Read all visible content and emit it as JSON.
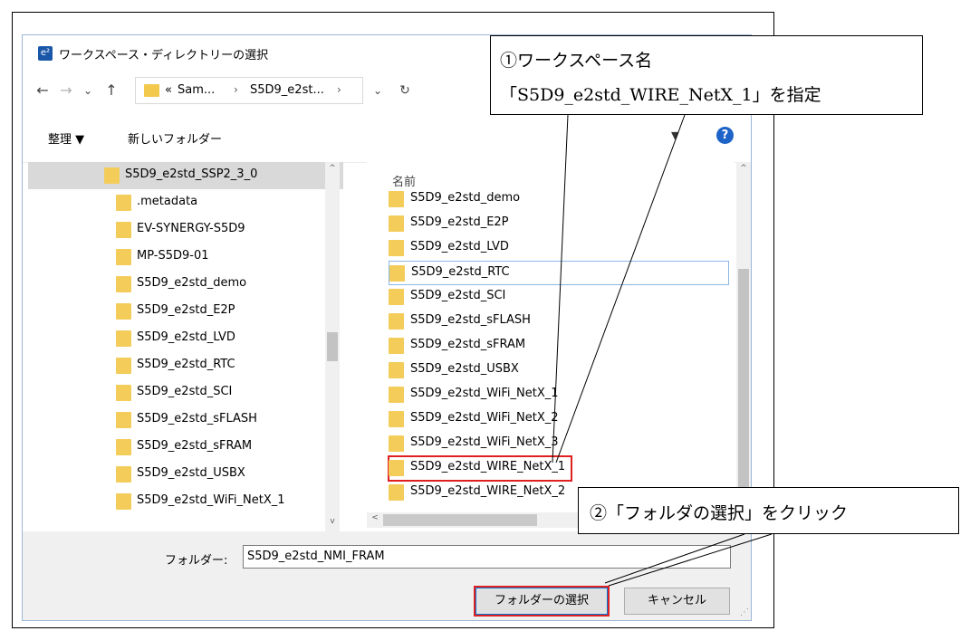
{
  "window": {
    "app_icon_text": "e²",
    "title": "ワークスペース・ディレクトリーの選択"
  },
  "nav": {
    "back": "←",
    "forward": "→",
    "history": "⌄",
    "up": "↑",
    "dropdown": "⌄",
    "refresh": "↻"
  },
  "address": {
    "overflow": "«",
    "crumbs": [
      "Sam...",
      "S5D9_e2st..."
    ],
    "separator": "›"
  },
  "toolbar": {
    "organize": "整理 ▼",
    "new_folder": "新しいフォルダー",
    "filter_arrow": "▼",
    "help": "?"
  },
  "tree": {
    "items": [
      {
        "label": "S5D9_e2std_SSP2_3_0",
        "selected": true
      },
      {
        "label": ".metadata"
      },
      {
        "label": "EV-SYNERGY-S5D9"
      },
      {
        "label": "MP-S5D9-01"
      },
      {
        "label": "S5D9_e2std_demo"
      },
      {
        "label": "S5D9_e2std_E2P"
      },
      {
        "label": "S5D9_e2std_LVD"
      },
      {
        "label": "S5D9_e2std_RTC"
      },
      {
        "label": "S5D9_e2std_SCI"
      },
      {
        "label": "S5D9_e2std_sFLASH"
      },
      {
        "label": "S5D9_e2std_sFRAM"
      },
      {
        "label": "S5D9_e2std_USBX"
      },
      {
        "label": "S5D9_e2std_WiFi_NetX_1"
      }
    ]
  },
  "list": {
    "column_name": "名前",
    "items": [
      {
        "label": "S5D9_e2std_demo"
      },
      {
        "label": "S5D9_e2std_E2P"
      },
      {
        "label": "S5D9_e2std_LVD"
      },
      {
        "label": "S5D9_e2std_RTC",
        "hover": true
      },
      {
        "label": "S5D9_e2std_SCI"
      },
      {
        "label": "S5D9_e2std_sFLASH"
      },
      {
        "label": "S5D9_e2std_sFRAM"
      },
      {
        "label": "S5D9_e2std_USBX"
      },
      {
        "label": "S5D9_e2std_WiFi_NetX_1"
      },
      {
        "label": "S5D9_e2std_WiFi_NetX_2"
      },
      {
        "label": "S5D9_e2std_WiFi_NetX_3"
      },
      {
        "label": "S5D9_e2std_WIRE_NetX_1",
        "marked": true
      },
      {
        "label": "S5D9_e2std_WIRE_NetX_2"
      }
    ]
  },
  "scroll": {
    "up": "^",
    "down": "v",
    "left": "<"
  },
  "folder_field": {
    "label": "フォルダー:",
    "value": "S5D9_e2std_NMI_FRAM"
  },
  "buttons": {
    "select": "フォルダーの選択",
    "cancel": "キャンセル"
  },
  "grip": "⋰",
  "annotations": {
    "callout1_line1": "①ワークスペース名",
    "callout1_line2": "「S5D9_e2std_WIRE_NetX_1」を指定",
    "callout2": "②「フォルダの選択」をクリック"
  },
  "colors": {
    "accent": "#0078d7",
    "highlight": "#e02020",
    "folder": "#f3cc5a",
    "selection": "#d9d9d9"
  }
}
